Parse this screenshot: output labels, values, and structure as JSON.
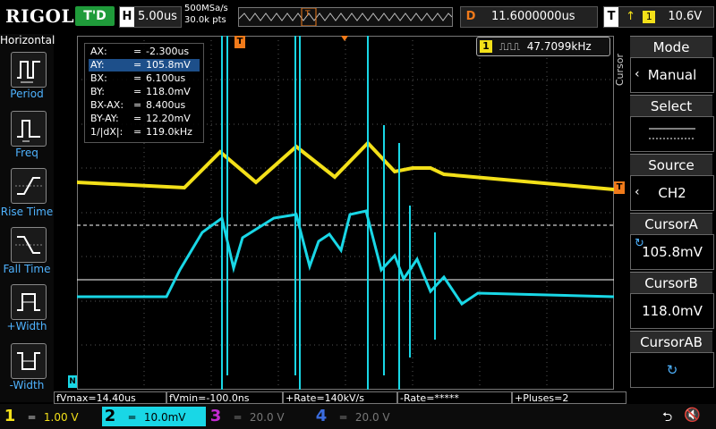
{
  "top": {
    "brand": "RIGOL",
    "trigger_status": "T'D",
    "horizontal_tag": "H",
    "timebase": "5.00us",
    "sample_rate": "500MSa/s",
    "memory_depth": "30.0k pts",
    "delay_tag": "D",
    "delay_value": "11.6000000us",
    "trigger_tag": "T",
    "trigger_channel": "1",
    "trigger_level": "10.6V"
  },
  "left_panel": {
    "title": "Horizontal",
    "items": [
      {
        "label": "Period"
      },
      {
        "label": "Freq"
      },
      {
        "label": "Rise Time"
      },
      {
        "label": "Fall Time"
      },
      {
        "label": "+Width"
      },
      {
        "label": "-Width"
      }
    ]
  },
  "right_panel": {
    "side_label": "Cursor",
    "mode_title": "Mode",
    "mode_value": "Manual",
    "select_title": "Select",
    "source_title": "Source",
    "source_value": "CH2",
    "cursora_title": "CursorA",
    "cursora_value": "105.8mV",
    "cursorb_title": "CursorB",
    "cursorb_value": "118.0mV",
    "cursorab_title": "CursorAB"
  },
  "cursor_readout": [
    {
      "k": "AX:",
      "v": "-2.300us"
    },
    {
      "k": "AY:",
      "v": "105.8mV"
    },
    {
      "k": "BX:",
      "v": "6.100us"
    },
    {
      "k": "BY:",
      "v": "118.0mV"
    },
    {
      "k": "BX-AX:",
      "v": "8.400us"
    },
    {
      "k": "BY-AY:",
      "v": "12.20mV"
    },
    {
      "k": "1/|dX|:",
      "v": "119.0kHz"
    }
  ],
  "frequency_counter": {
    "channel": "1",
    "value": "47.7099kHz"
  },
  "measurements": [
    "fVmax=14.40us",
    "fVmin=-100.0ns",
    "+Rate=140kV/s",
    "-Rate=*****",
    "+Pluses=2"
  ],
  "channels": [
    {
      "num": "1",
      "scale": "1.00 V",
      "color": "#f3e019"
    },
    {
      "num": "2",
      "scale": "10.0mV",
      "color": "#19d7e6"
    },
    {
      "num": "3",
      "scale": "20.0 V",
      "color": "#c32ad0"
    },
    {
      "num": "4",
      "scale": "20.0 V",
      "color": "#3b6de0"
    }
  ],
  "colors": {
    "ch1": "#f3e019",
    "ch2": "#19d7e6",
    "trigger_marker": "#f07a1a",
    "grid": "#666666"
  },
  "markers": {
    "trigger_pos": "T",
    "ch2_ground": "N"
  }
}
